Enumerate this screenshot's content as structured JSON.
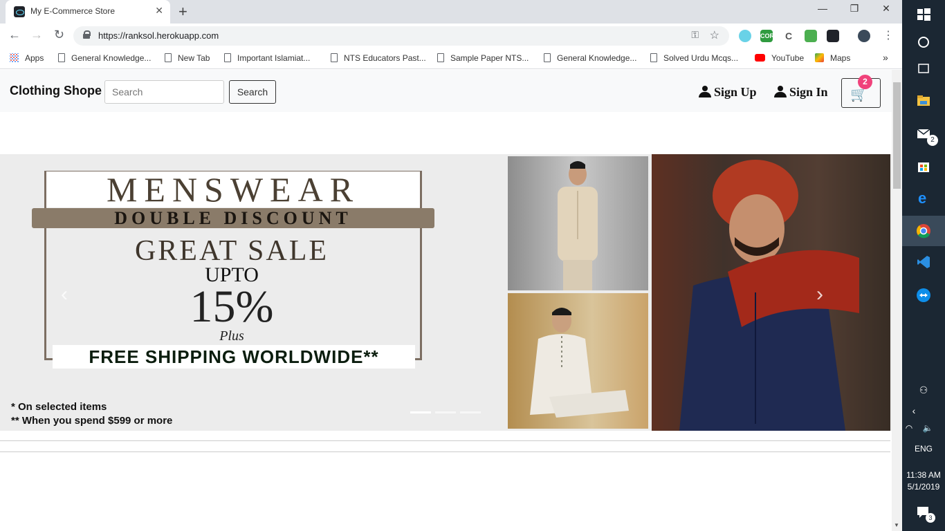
{
  "browser": {
    "tab_title": "My E-Commerce Store",
    "url": "https://ranksol.herokuapp.com",
    "bookmarks": [
      {
        "label": "Apps"
      },
      {
        "label": "General Knowledge..."
      },
      {
        "label": "New Tab"
      },
      {
        "label": "Important Islamiat..."
      },
      {
        "label": "NTS Educators Past..."
      },
      {
        "label": "Sample Paper NTS..."
      },
      {
        "label": "General Knowledge..."
      },
      {
        "label": "Solved Urdu Mcqs..."
      },
      {
        "label": "YouTube"
      },
      {
        "label": "Maps"
      }
    ],
    "extensions": [
      {
        "label": "CORS"
      },
      {
        "label": "C"
      }
    ],
    "more_bookmarks": "»"
  },
  "navbar": {
    "brand": "Clothing Shope",
    "search_placeholder": "Search",
    "search_button": "Search",
    "signup": "Sign Up",
    "signin": "Sign In",
    "cart_count": "2"
  },
  "banner": {
    "line1": "MENSWEAR",
    "line2": "DOUBLE DISCOUNT",
    "line3": "GREAT SALE",
    "line4": "UPTO",
    "line5": "15%",
    "line6": "Plus",
    "line7": "FREE SHIPPING WORLDWIDE**",
    "note1": "* On selected items",
    "note2": "** When you spend $599 or more",
    "slides": 3,
    "active_slide": 1
  },
  "taskbar": {
    "mail_badge": "2",
    "language": "ENG",
    "time": "11:38 AM",
    "date": "5/1/2019",
    "notification_count": "3"
  },
  "colors": {
    "badge": "#f0427b",
    "taskbar": "#1b2733",
    "banner_brown": "#8a7b69"
  }
}
